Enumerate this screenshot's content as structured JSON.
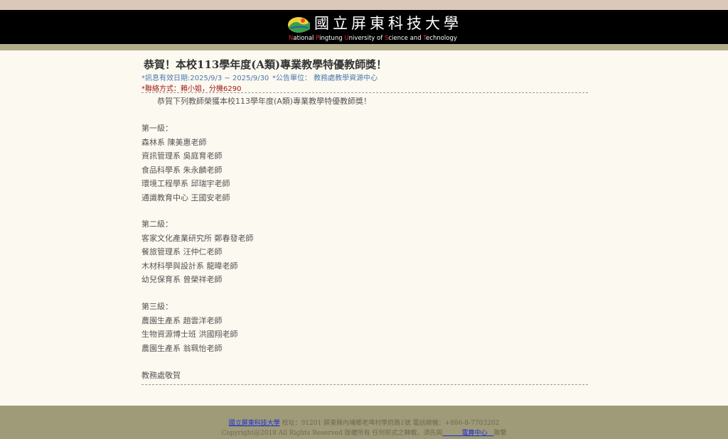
{
  "header": {
    "school_name_zh": "國立屏東科技大學",
    "school_name_en": [
      "N",
      "ational ",
      "P",
      "ingtung ",
      "U",
      "niversity of ",
      "S",
      "cience and ",
      "T",
      "echnology"
    ]
  },
  "announcement": {
    "title": "恭賀！本校113學年度(A類)專業教學特優教師獎！",
    "validity": "*訊息有效日期:2025/9/3 ~ 2025/9/30",
    "unit": "*公告單位： 教務處教學資源中心",
    "contact": "*聯絡方式：賴小姐，分機6290",
    "lines": [
      "　　恭賀下列教師榮獲本校113學年度(A類)專業教學特優教師獎！",
      "",
      "第一級：",
      "森林系 陳美惠老師",
      "資訊管理系 吳庭育老師",
      "食品科學系 朱永麟老師",
      "環境工程學系 邱瑞宇老師",
      "通識教育中心 王國安老師",
      "",
      "第二級：",
      "客家文化產業研究所 鄭春發老師",
      "餐旅管理系 汪仲仁老師",
      "木材科學與設計系 龍暐老師",
      "幼兒保育系 曾榮祥老師",
      "",
      "第三級：",
      "農園生產系 趙雲洋老師",
      "生物資源博士班 洪國翔老師",
      "農園生產系 翁珮怡老師",
      "",
      "教務處敬賀"
    ]
  },
  "footer": {
    "school_link": "國立屏東科技大學",
    "address": " 校址：91201 屏東縣內埔鄉老埤村學府路1號 電話總機：+886-8-7703202",
    "copyright_prefix": "Copyright@2018 All Rights Reserved 版權所有 任何形式之轉載，須先與",
    "center_link": "　　　電算中心　",
    "copyright_suffix": "聯繫"
  },
  "colors": {
    "header_bg": "#000000",
    "accent_red": "#e02828",
    "meta_blue": "#4a78b0",
    "contact_red": "#a01818",
    "footer_bg": "#9f9a78"
  }
}
